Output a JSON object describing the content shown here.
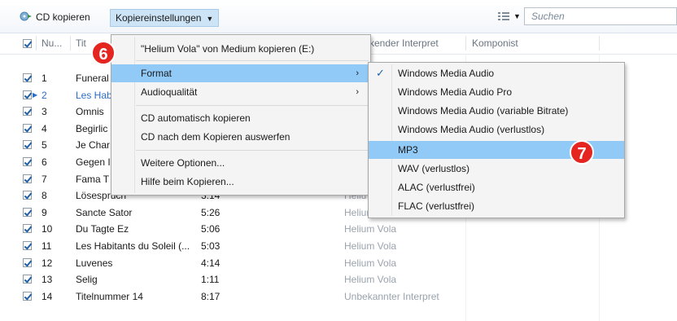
{
  "toolbar": {
    "copy_cd_label": "CD kopieren",
    "copy_settings_label": "Kopiereinstellungen",
    "search_placeholder": "Suchen"
  },
  "table": {
    "columns": {
      "num": "Nu...",
      "title": "Tit",
      "artist_partial": "kender Interpret",
      "composer": "Komponist"
    },
    "rows": [
      {
        "num": "1",
        "title": "Funeral",
        "length": "",
        "artist": ""
      },
      {
        "num": "2",
        "title": "Les Hab",
        "length": "",
        "artist": ""
      },
      {
        "num": "3",
        "title": "Omnis",
        "length": "",
        "artist": ""
      },
      {
        "num": "4",
        "title": "Begirlic",
        "length": "",
        "artist": ""
      },
      {
        "num": "5",
        "title": "Je Char",
        "length": "",
        "artist": ""
      },
      {
        "num": "6",
        "title": "Gegen I",
        "length": "",
        "artist": ""
      },
      {
        "num": "7",
        "title": "Fama T",
        "length": "",
        "artist": ""
      },
      {
        "num": "8",
        "title": "Lösespruch",
        "length": "3:14",
        "artist": "Heliu"
      },
      {
        "num": "9",
        "title": "Sancte Sator",
        "length": "5:26",
        "artist": "Helium Vola"
      },
      {
        "num": "10",
        "title": "Du Tagte Ez",
        "length": "5:06",
        "artist": "Helium Vola"
      },
      {
        "num": "11",
        "title": "Les Habitants du Soleil (...",
        "length": "5:03",
        "artist": "Helium Vola"
      },
      {
        "num": "12",
        "title": "Luvenes",
        "length": "4:14",
        "artist": "Helium Vola"
      },
      {
        "num": "13",
        "title": "Selig",
        "length": "1:11",
        "artist": "Helium Vola"
      },
      {
        "num": "14",
        "title": "Titelnummer 14",
        "length": "8:17",
        "artist": "Unbekannter Interpret"
      }
    ]
  },
  "menu": {
    "items": [
      {
        "label": "\"Helium Vola\" von Medium kopieren (E:)"
      },
      {
        "label": "Format"
      },
      {
        "label": "Audioqualität"
      },
      {
        "label": "CD automatisch kopieren"
      },
      {
        "label": "CD nach dem Kopieren auswerfen"
      },
      {
        "label": "Weitere Optionen..."
      },
      {
        "label": "Hilfe beim Kopieren..."
      }
    ]
  },
  "submenu": {
    "items": [
      {
        "label": "Windows Media Audio"
      },
      {
        "label": "Windows Media Audio Pro"
      },
      {
        "label": "Windows Media Audio (variable Bitrate)"
      },
      {
        "label": "Windows Media Audio (verlustlos)"
      },
      {
        "label": "MP3"
      },
      {
        "label": "WAV (verlustlos)"
      },
      {
        "label": "ALAC (verlustfrei)"
      },
      {
        "label": "FLAC (verlustfrei)"
      }
    ]
  },
  "badges": {
    "step6": "6",
    "step7": "7"
  }
}
